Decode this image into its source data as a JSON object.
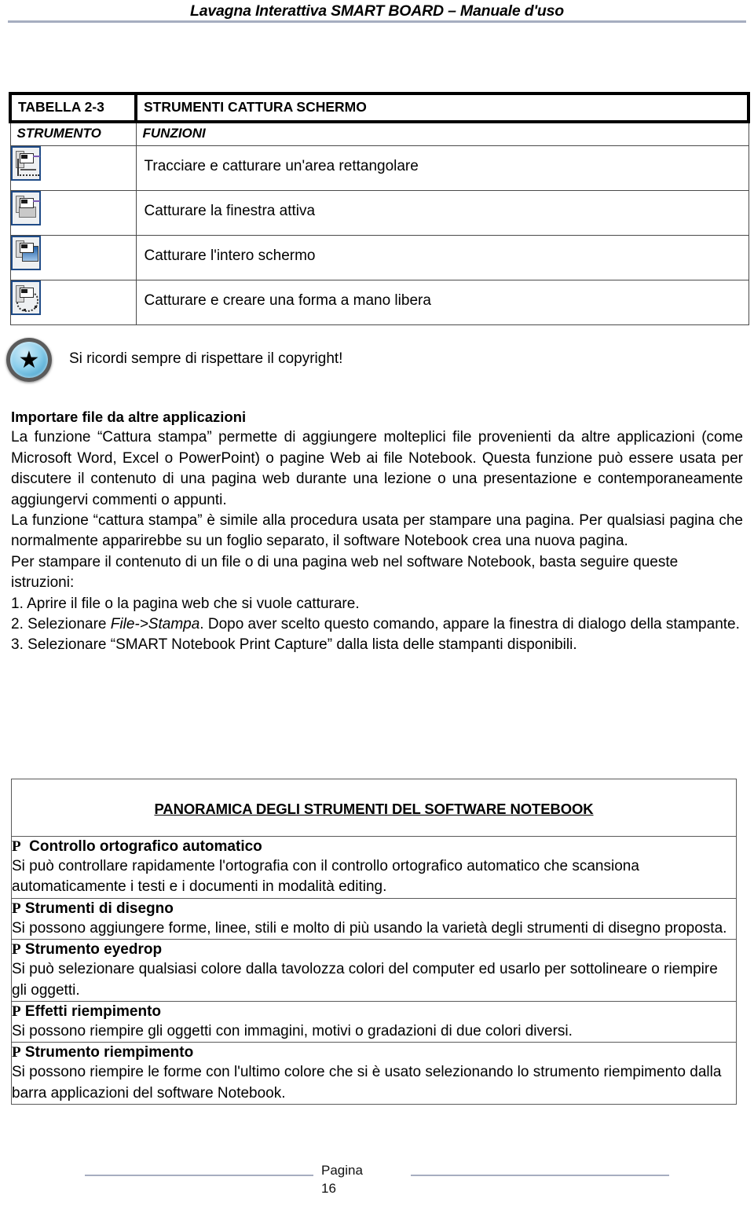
{
  "header": {
    "title": "Lavagna Interattiva SMART BOARD – Manuale d'uso",
    "rule_color": "#a6aec0"
  },
  "tools_table": {
    "label": "TABELLA 2-3",
    "title": "STRUMENTI CATTURA SCHERMO",
    "columns": [
      "STRUMENTO",
      "FUNZIONI"
    ],
    "rows": [
      {
        "icon": "capture-area-icon",
        "function": "Tracciare e catturare un'area rettangolare"
      },
      {
        "icon": "capture-window-icon",
        "function": "Catturare la finestra attiva"
      },
      {
        "icon": "capture-screen-icon",
        "function": "Catturare l'intero schermo"
      },
      {
        "icon": "capture-freehand-icon",
        "function": "Catturare e creare una forma a mano libera"
      }
    ]
  },
  "note": {
    "icon": "star-badge-icon",
    "star_glyph": "★",
    "text": "Si ricordi sempre di rispettare il copyright!"
  },
  "body": {
    "heading": "Importare file da altre applicazioni",
    "paragraph_1": "La funzione “Cattura stampa” permette di aggiungere molteplici file provenienti da altre applicazioni (come Microsoft Word, Excel o PowerPoint) o pagine Web ai file Notebook. Questa funzione può essere usata per discutere il contenuto di una pagina web durante una lezione o una presentazione e contemporaneamente aggiungervi commenti o appunti.",
    "paragraph_2": "La funzione “cattura stampa” è simile alla procedura usata per stampare una pagina. Per qualsiasi pagina che normalmente apparirebbe su un foglio separato, il software Notebook crea una nuova pagina.",
    "paragraph_3": "Per stampare il contenuto di un file o di una pagina web nel software Notebook, basta seguire queste istruzioni:",
    "steps": [
      {
        "number": "1.",
        "text": "Aprire il file o la pagina web che si vuole catturare."
      },
      {
        "number": "2.",
        "pre": "Selezionare ",
        "emphasis": "File->Stampa",
        "post": ". Dopo aver scelto questo comando, appare la finestra di dialogo della stampante."
      },
      {
        "number": "3.",
        "text": "Selezionare “SMART Notebook Print Capture” dalla lista delle stampanti disponibili."
      }
    ]
  },
  "overview": {
    "title": "PANORAMICA DEGLI STRUMENTI DEL SOFTWARE NOTEBOOK",
    "bullet_glyph": "P",
    "items": [
      {
        "heading": "Controllo ortografico automatico",
        "body": "Si può controllare rapidamente l'ortografia con il controllo ortografico automatico che scansiona automaticamente i testi e i documenti in modalità editing."
      },
      {
        "heading": "Strumenti di disegno",
        "body": "Si possono aggiungere forme, linee, stili e molto di più usando la varietà degli strumenti di disegno proposta."
      },
      {
        "heading": "Strumento eyedrop",
        "body": "Si può selezionare qualsiasi colore dalla tavolozza colori del computer ed usarlo per sottolineare o riempire gli oggetti."
      },
      {
        "heading": "Effetti riempimento",
        "body": "Si possono riempire gli oggetti con immagini, motivi o gradazioni di due colori diversi."
      },
      {
        "heading": "Strumento riempimento",
        "body": "Si possono riempire le forme con l'ultimo colore che si è usato selezionando lo strumento riempimento dalla barra applicazioni del software Notebook."
      }
    ]
  },
  "footer": {
    "label": "Pagina",
    "page_number": "16"
  }
}
